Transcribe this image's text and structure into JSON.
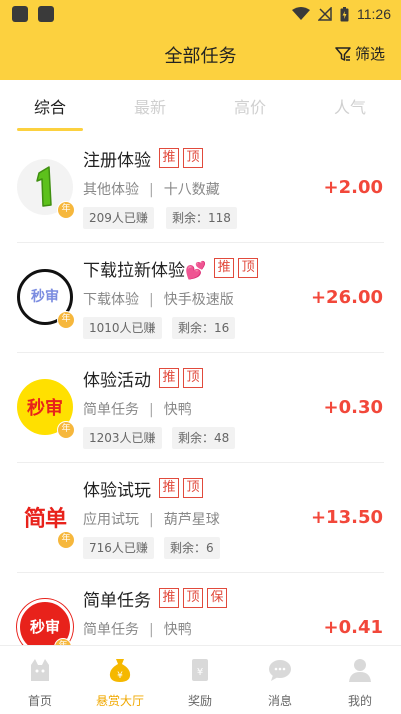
{
  "status_bar": {
    "time": "11:26"
  },
  "header": {
    "title": "全部任务",
    "filter_label": "筛选"
  },
  "tabs": [
    {
      "label": "综合",
      "active": true
    },
    {
      "label": "最新",
      "active": false
    },
    {
      "label": "高价",
      "active": false
    },
    {
      "label": "人气",
      "active": false
    }
  ],
  "tasks": [
    {
      "title": "注册体验",
      "tags": [
        "推",
        "顶"
      ],
      "category": "其他体验",
      "source": "十八数藏",
      "earned": "209人已赚",
      "remaining": "剩余：118",
      "price": "+2.00",
      "badge": "年"
    },
    {
      "title": "下载拉新体验💕",
      "tags": [
        "推",
        "顶"
      ],
      "category": "下载体验",
      "source": "快手极速版",
      "earned": "1010人已赚",
      "remaining": "剩余：16",
      "price": "+26.00",
      "badge": "年",
      "logo_text": "秒审"
    },
    {
      "title": "体验活动",
      "tags": [
        "推",
        "顶"
      ],
      "category": "简单任务",
      "source": "快鸭",
      "earned": "1203人已赚",
      "remaining": "剩余：48",
      "price": "+0.30",
      "badge": "年",
      "logo_text": "秒审"
    },
    {
      "title": "体验试玩",
      "tags": [
        "推",
        "顶"
      ],
      "category": "应用试玩",
      "source": "葫芦星球",
      "earned": "716人已赚",
      "remaining": "剩余：6",
      "price": "+13.50",
      "badge": "年",
      "logo_text": "简单"
    },
    {
      "title": "简单任务",
      "tags": [
        "推",
        "顶",
        "保"
      ],
      "category": "简单任务",
      "source": "快鸭",
      "earned": "",
      "remaining": "",
      "price": "+0.41",
      "badge": "年",
      "logo_text": "秒审"
    }
  ],
  "bottom_nav": [
    {
      "label": "首页",
      "icon": "home-cat-icon",
      "active": false
    },
    {
      "label": "悬赏大厅",
      "icon": "money-bag-icon",
      "active": true
    },
    {
      "label": "奖励",
      "icon": "reward-icon",
      "active": false
    },
    {
      "label": "消息",
      "icon": "message-icon",
      "active": false
    },
    {
      "label": "我的",
      "icon": "profile-icon",
      "active": false
    }
  ],
  "colors": {
    "brand": "#fcd13f",
    "price": "#f2473a",
    "tag": "#e14a3c",
    "nav_active": "#f0a800"
  }
}
